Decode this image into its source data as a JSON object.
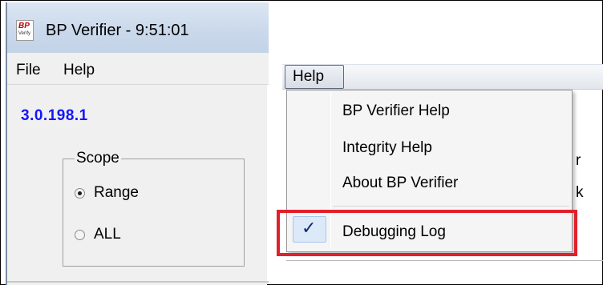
{
  "window": {
    "title": "BP Verifier  - 9:51:01",
    "icon_name": "bp-verifier-app-icon",
    "icon_text_top": "BP",
    "icon_text_bottom": "Verify"
  },
  "menubar": {
    "items": [
      {
        "label": "File"
      },
      {
        "label": "Help"
      }
    ]
  },
  "version": "3.0.198.1",
  "scope": {
    "legend": "Scope",
    "options": [
      {
        "label": "Range",
        "selected": true
      },
      {
        "label": "ALL",
        "selected": false
      }
    ]
  },
  "help_menu": {
    "open_label": "Help",
    "items": [
      {
        "label": "BP Verifier Help",
        "checked": false
      },
      {
        "label": "Integrity Help",
        "checked": false
      },
      {
        "label": "About BP Verifier",
        "checked": false
      },
      {
        "label": "Debugging Log",
        "checked": true
      }
    ],
    "check_glyph": "✓",
    "highlight_color": "#e0202c"
  },
  "background_text": [
    "r",
    "k"
  ]
}
